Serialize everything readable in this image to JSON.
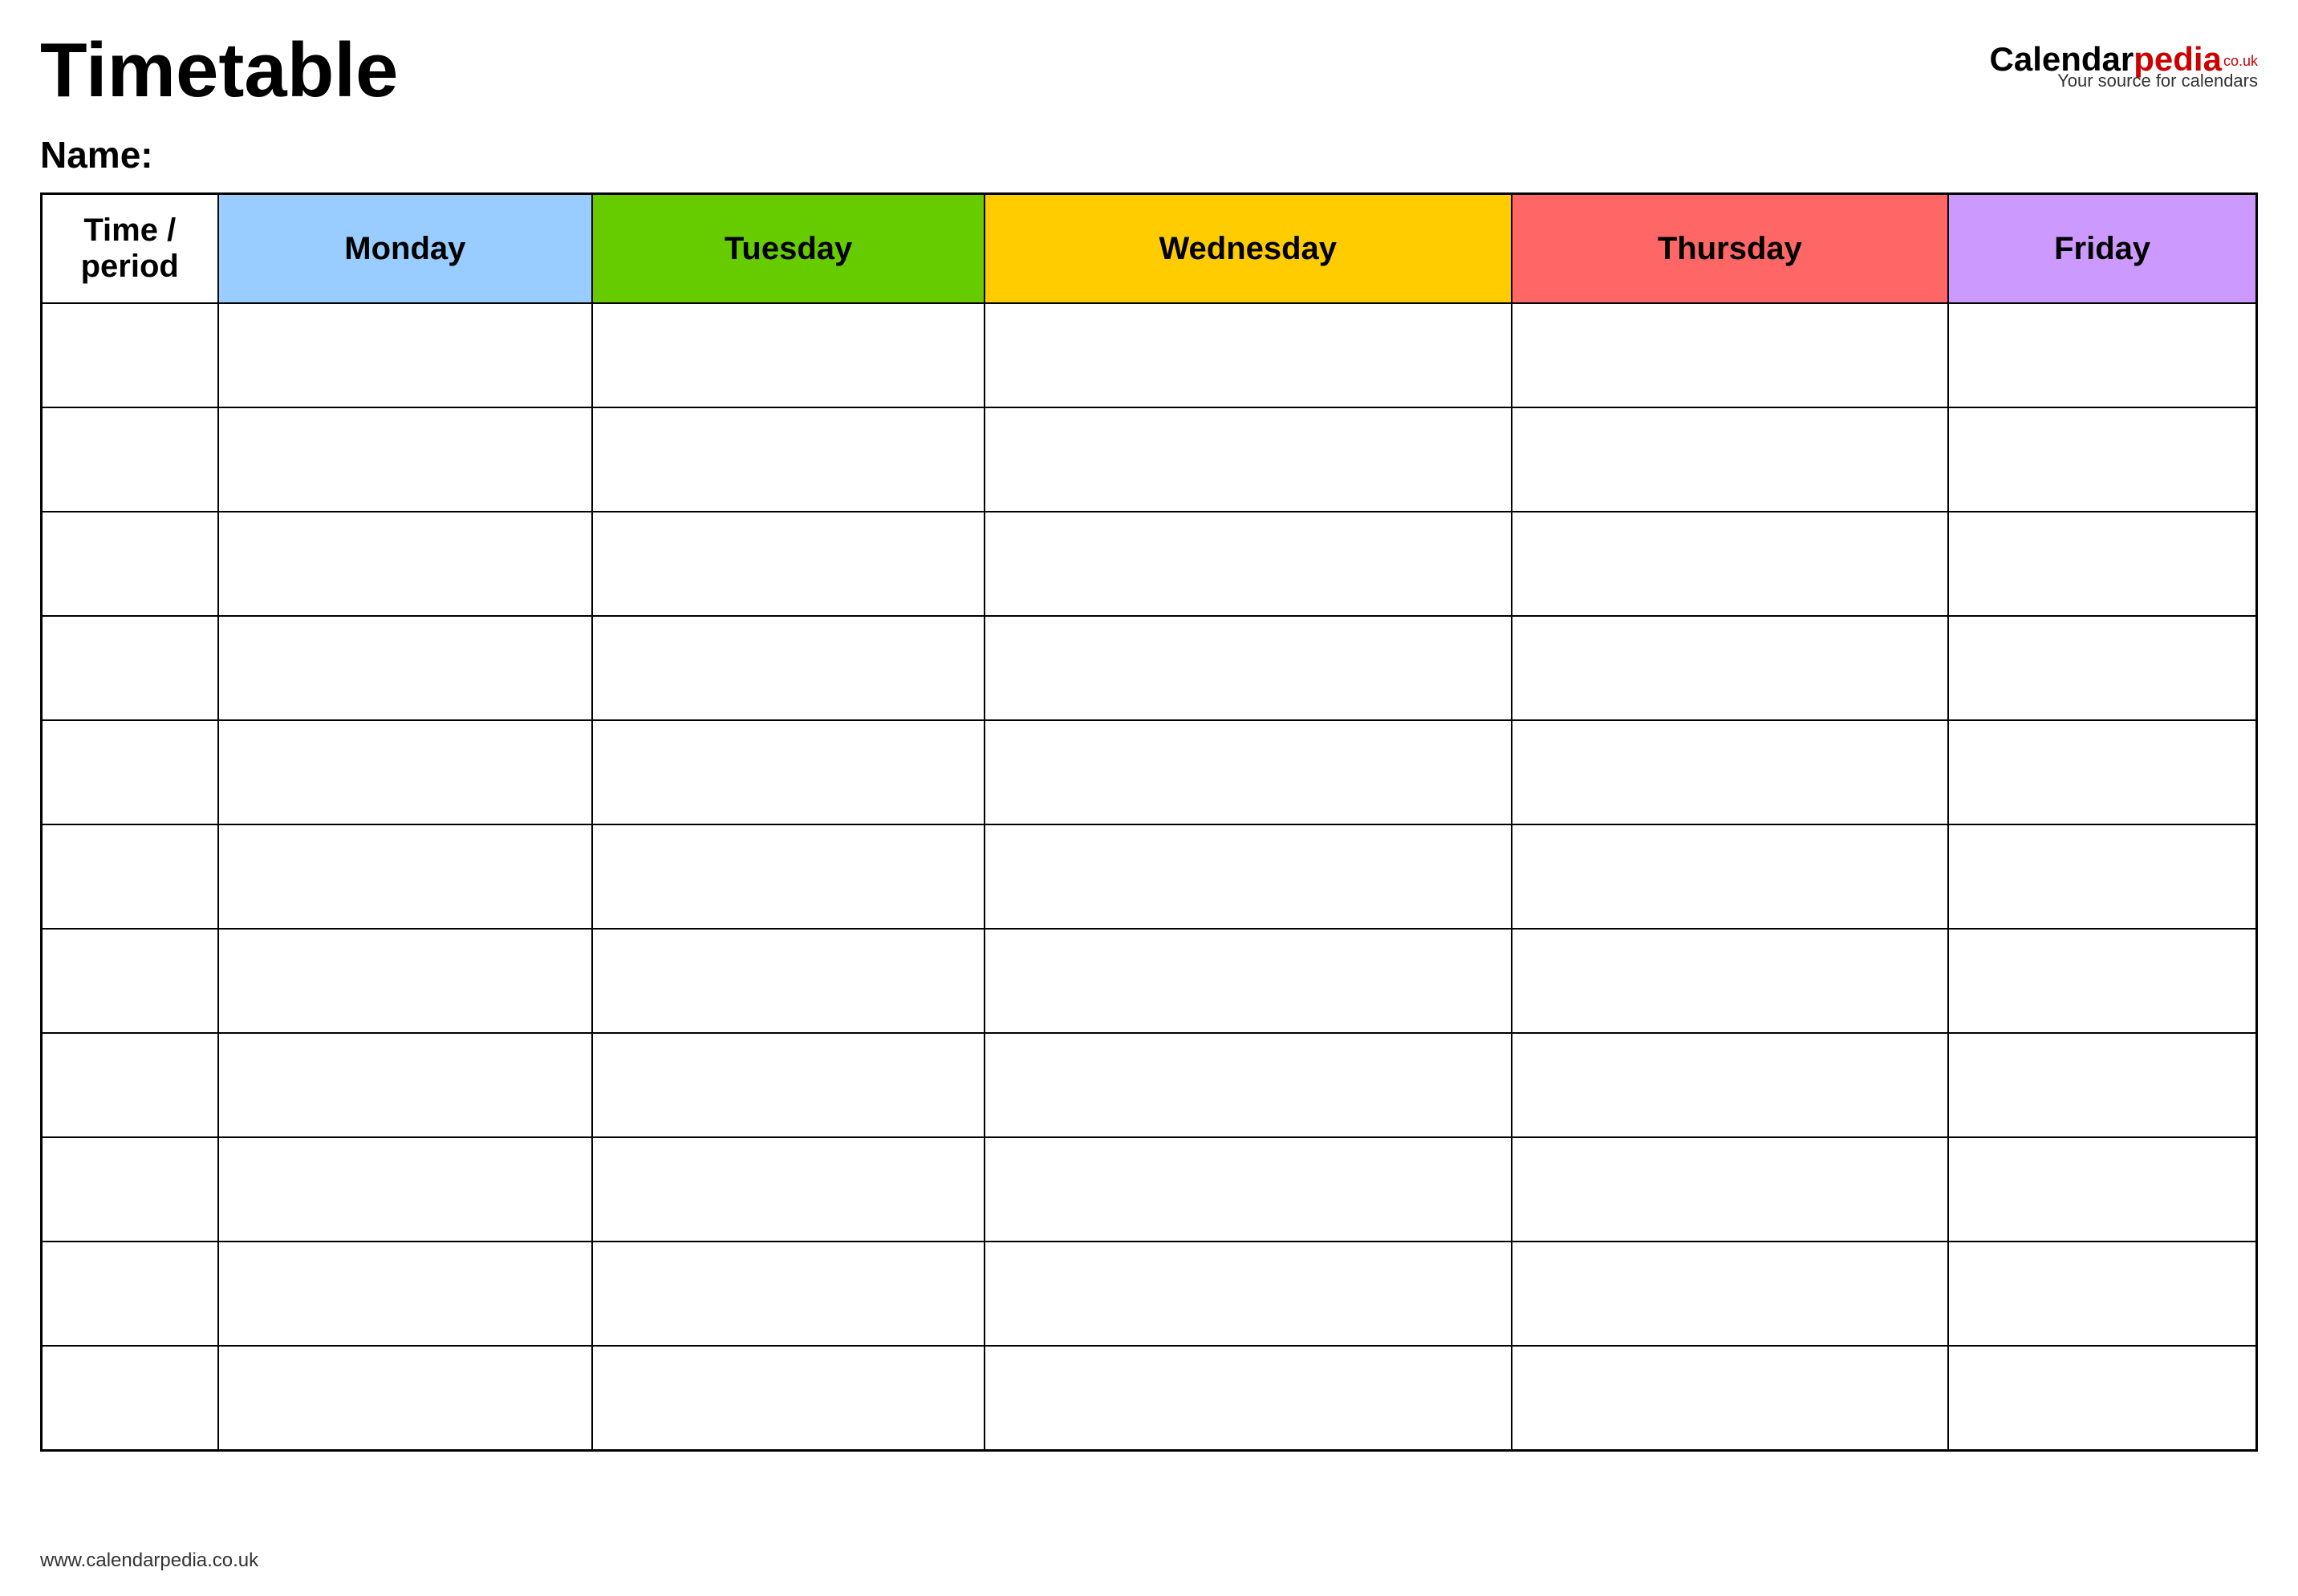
{
  "header": {
    "title": "Timetable",
    "logo_calendar": "Calendar",
    "logo_pedia": "pedia",
    "logo_super": "co.uk",
    "logo_tagline": "Your source for calendars"
  },
  "name_section": {
    "label": "Name:"
  },
  "table": {
    "columns": [
      {
        "key": "time",
        "label": "Time / period",
        "class": "col-time"
      },
      {
        "key": "monday",
        "label": "Monday",
        "class": "col-monday"
      },
      {
        "key": "tuesday",
        "label": "Tuesday",
        "class": "col-tuesday"
      },
      {
        "key": "wednesday",
        "label": "Wednesday",
        "class": "col-wednesday"
      },
      {
        "key": "thursday",
        "label": "Thursday",
        "class": "col-thursday"
      },
      {
        "key": "friday",
        "label": "Friday",
        "class": "col-friday"
      }
    ],
    "row_count": 11
  },
  "footer": {
    "url": "www.calendarpedia.co.uk"
  }
}
